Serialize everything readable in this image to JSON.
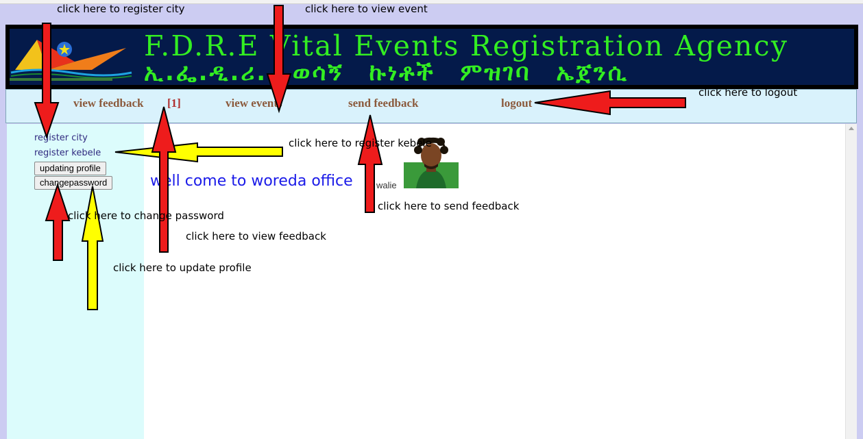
{
  "banner": {
    "title_en": "F.D.R.E Vital Events Registration Agency",
    "title_am": "ኢ.ፌ.ዲ.ሪ. ወሳኝ ኩነቶች ምዝገባ ኤጀንሲ",
    "logo_name": "vital-events-agency-logo"
  },
  "nav": {
    "view_feedback": "view feedback",
    "feedback_count": "[1]",
    "view_events": "view events",
    "send_feedback": "send feedback",
    "logout": "logout"
  },
  "sidebar": {
    "register_city": "register city",
    "register_kebele": "register kebele",
    "updating_profile": "updating profile",
    "change_password": "changepassword"
  },
  "main": {
    "welcome": "well come to woreda office",
    "username": "walie"
  },
  "annotations": {
    "register_city": "click here to register city",
    "view_event": "click here to view event",
    "logout": "click here to logout",
    "register_kebele": "click here to register kebele",
    "send_feedback": "click here to send feedback",
    "change_password": "click here to change password",
    "view_feedback": "click here to view feedback",
    "update_profile": "click here to update profile"
  },
  "colors": {
    "page_bg": "#ccccf2",
    "banner_bg": "#041a4a",
    "banner_text": "#33ee22",
    "nav_bg": "#d9f2fc",
    "nav_link": "#8b5a3c",
    "sidebar_bg": "#dcfcfc",
    "welcome_text": "#1a1ae8",
    "arrow_red": "#ee1c1c",
    "arrow_yellow": "#ffff00"
  }
}
